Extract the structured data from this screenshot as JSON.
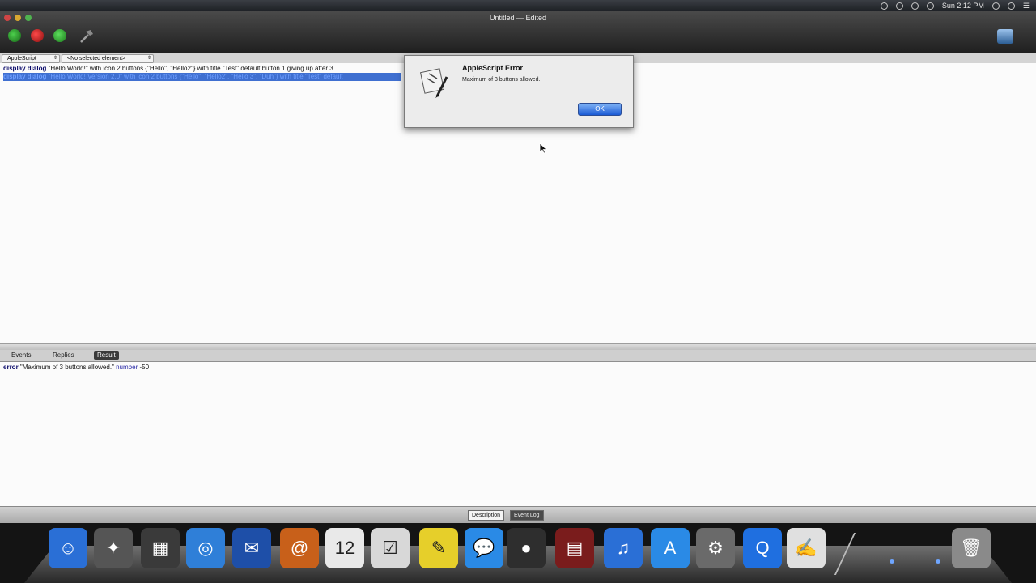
{
  "window": {
    "title": "Untitled — Edited"
  },
  "menubar": {
    "clock": "Sun 2:12 PM"
  },
  "navbar": {
    "language_popup": "AppleScript",
    "element_popup": "<No selected element>"
  },
  "editor": {
    "line1": {
      "kw": "display dialog",
      "rest": "\"Hello World!\" with icon 2 buttons {\"Hello\", \"Hello2\"} with title \"Test\" default button 1 giving up after 3"
    },
    "line2": {
      "kw": "display dialog",
      "rest": "\"Hello World! Version 2.0\" with icon 2 buttons {\"Hello\", \"Hello2\", \"Hello 3\", \"Duh\"} with title \"Test\" default"
    }
  },
  "log_tabs": {
    "events": "Events",
    "replies": "Replies",
    "result": "Result"
  },
  "result": {
    "kw": "error",
    "message": "\"Maximum of 3 buttons allowed.\"",
    "number_label": "number",
    "number_value": "-50"
  },
  "bottom_tabs": {
    "description": "Description",
    "event_log": "Event Log"
  },
  "dialog": {
    "title": "AppleScript Error",
    "message": "Maximum of 3 buttons allowed.",
    "ok": "OK"
  },
  "dock": {
    "items": [
      {
        "name": "finder-icon",
        "glyph": "☺",
        "color": "#2a6fd6"
      },
      {
        "name": "launchpad-icon",
        "glyph": "✦",
        "color": "#555555"
      },
      {
        "name": "mission-control-icon",
        "glyph": "▦",
        "color": "#3a3a3a"
      },
      {
        "name": "safari-icon",
        "glyph": "◎",
        "color": "#2f7fd8"
      },
      {
        "name": "mail-icon",
        "glyph": "✉",
        "color": "#1e4fa8"
      },
      {
        "name": "address-book-icon",
        "glyph": "@",
        "color": "#c8601a"
      },
      {
        "name": "ical-icon",
        "glyph": "12",
        "color": "#e9e9e9"
      },
      {
        "name": "reminders-icon",
        "glyph": "☑",
        "color": "#d8d8d8"
      },
      {
        "name": "stickies-icon",
        "glyph": "✎",
        "color": "#e6cf2a"
      },
      {
        "name": "ichat-icon",
        "glyph": "💬",
        "color": "#2a8ae6"
      },
      {
        "name": "facetime-icon",
        "glyph": "●",
        "color": "#2e2e2e"
      },
      {
        "name": "photo-booth-icon",
        "glyph": "▤",
        "color": "#7a1c1c"
      },
      {
        "name": "itunes-icon",
        "glyph": "♫",
        "color": "#2a6fd6"
      },
      {
        "name": "app-store-icon",
        "glyph": "A",
        "color": "#2a8ae6"
      },
      {
        "name": "system-preferences-icon",
        "glyph": "⚙",
        "color": "#6a6a6a"
      },
      {
        "name": "quicktime-icon",
        "glyph": "Q",
        "color": "#1f6fe0"
      },
      {
        "name": "script-editor-icon",
        "glyph": "✍",
        "color": "#e0e0e0"
      }
    ],
    "trash": {
      "name": "trash-icon",
      "glyph": "🗑",
      "color": "#8a8a8a"
    }
  },
  "colors": {
    "accent": "#3f6fd0",
    "ok_button": "#1a5ad4"
  }
}
